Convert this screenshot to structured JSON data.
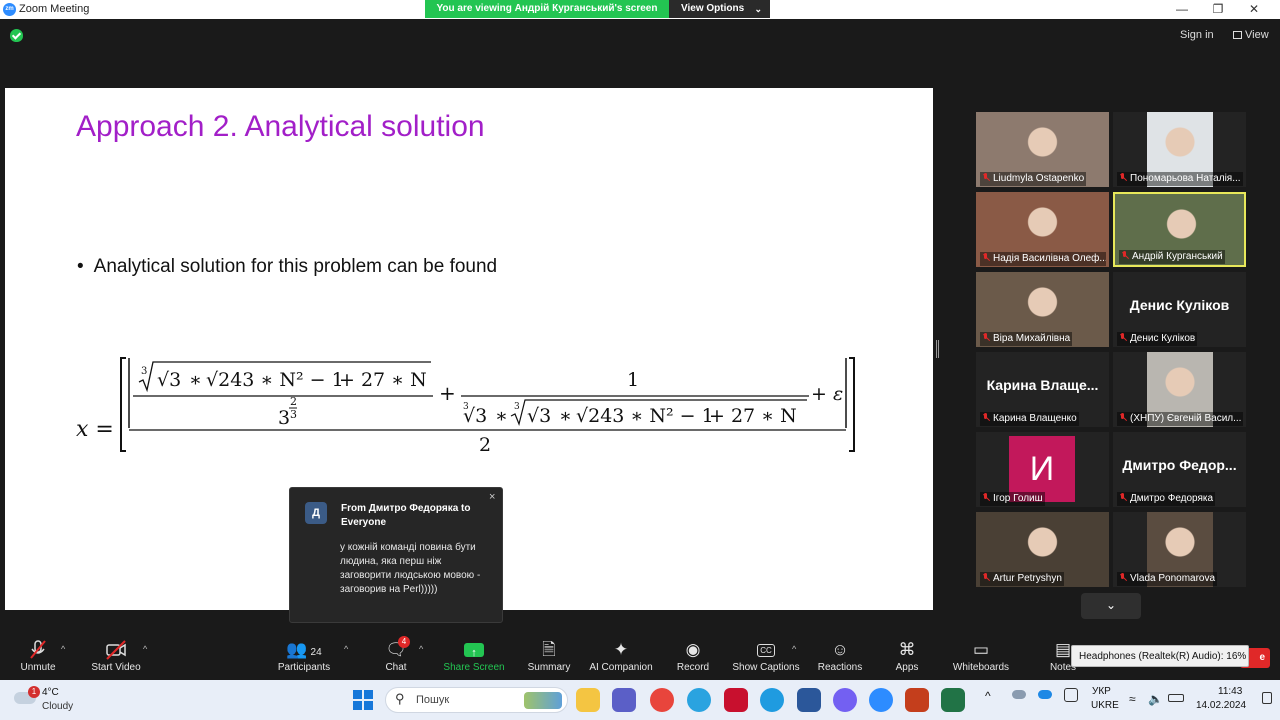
{
  "window": {
    "title": "Zoom Meeting",
    "app_icon_text": "zm",
    "minimize": "—",
    "maximize": "❐",
    "close": "✕"
  },
  "banner": {
    "viewing_text": "You are viewing Андрій Курганський's screen",
    "view_options": "View Options",
    "view_options_caret": "⌄"
  },
  "topbar": {
    "signin": "Sign in",
    "view": "View"
  },
  "slide": {
    "title": "Approach 2. Analytical solution",
    "bullet": "Analytical solution for this problem can be found",
    "bullet_mark": "•",
    "formula": {
      "lhs": "x =",
      "cbrt_index": "3",
      "sqrt3": "√3",
      "times1": "∗",
      "inner_sqrt": "√243 ∗ N² − 1",
      "plus_term": "+ 27 ∗ N",
      "den_base": "3",
      "den_exp_num": "2",
      "den_exp_den": "3",
      "plus": "+",
      "one": "1",
      "eps": "+ ε",
      "two": "2"
    }
  },
  "participants": [
    {
      "name": "Liudmyla Ostapenko",
      "type": "video",
      "bg": "#8d7a6e"
    },
    {
      "name": "Пономарьова Наталія...",
      "type": "video",
      "bg": "#dfe3e6"
    },
    {
      "name": "Надія Василівна Олеф...",
      "type": "video",
      "bg": "#8a5a46"
    },
    {
      "name": "Андрій Курганський",
      "type": "video",
      "bg": "#5f6e4b",
      "active": true
    },
    {
      "name": "Віра Михайлівна",
      "type": "video",
      "bg": "#6b5a4a"
    },
    {
      "name": "Денис Куліков",
      "type": "text",
      "display": "Денис Куліков"
    },
    {
      "name": "Карина Влащенко",
      "type": "text",
      "display": "Карина  Влаще..."
    },
    {
      "name": "(ХНПУ) Євгеній Васил...",
      "type": "video",
      "bg": "#b9b6b0"
    },
    {
      "name": "Ігор Голиш",
      "type": "avatar",
      "initial": "И",
      "bg": "#c2185b"
    },
    {
      "name": "Дмитро Федоряка",
      "type": "text",
      "display": "Дмитро  Федор..."
    },
    {
      "name": "Artur Petryshyn",
      "type": "video",
      "bg": "#4a4035"
    },
    {
      "name": "Vlada Ponomarova",
      "type": "video",
      "bg": "#5a4c40"
    }
  ],
  "gallery_more_icon": "⌄",
  "chat_popup": {
    "avatar": "Д",
    "from": "From Дмитро Федоряка to Everyone",
    "message": "у кожній команді повина бути людина, яка перш ніж заговорити людською мовою - заговорив на Perl)))))",
    "close": "×"
  },
  "toolbar": {
    "unmute": "Unmute",
    "start_video": "Start Video",
    "participants": "Participants",
    "participants_count": "24",
    "chat": "Chat",
    "chat_badge": "4",
    "share_screen": "Share Screen",
    "summary": "Summary",
    "ai_companion": "AI Companion",
    "record": "Record",
    "show_captions": "Show Captions",
    "cc": "CC",
    "reactions": "Reactions",
    "apps": "Apps",
    "whiteboards": "Whiteboards",
    "notes": "Notes",
    "caret": "^",
    "leave": "e",
    "headphones_tip": "Headphones (Realtek(R) Audio): 16%"
  },
  "taskbar": {
    "weather_temp": "4°C",
    "weather_cond": "Cloudy",
    "weather_badge": "1",
    "search_placeholder": "Пошук",
    "lang_top": "УКР",
    "lang_bottom": "UKRE",
    "time": "11:43",
    "date": "14.02.2024",
    "tray_caret": "^"
  }
}
